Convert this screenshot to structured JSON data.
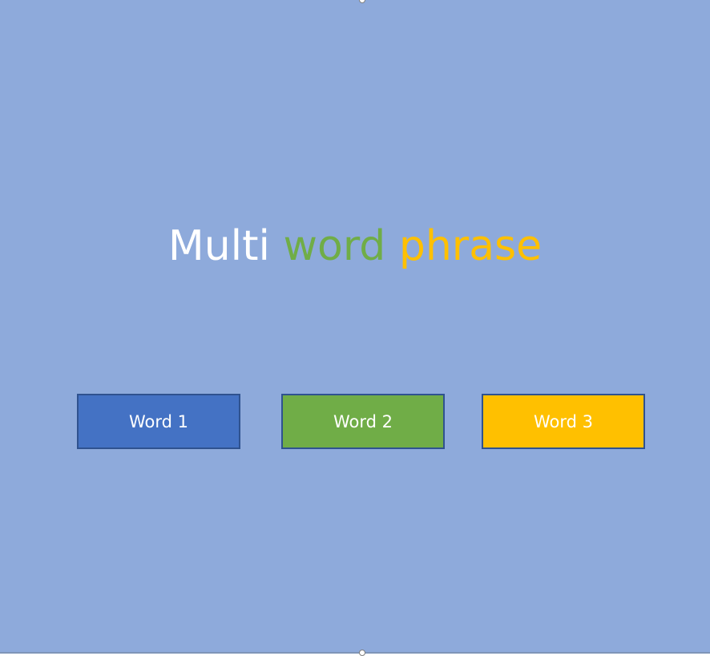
{
  "colors": {
    "background": "#8eaadb",
    "blue": "#4472c4",
    "green": "#70ad47",
    "gold": "#ffc000",
    "white": "#ffffff",
    "box_border": "#2f528f"
  },
  "phrase": {
    "part1": "Multi",
    "part2": "word",
    "part3": "phrase"
  },
  "boxes": [
    {
      "label": "Word 1",
      "color": "#4472c4"
    },
    {
      "label": "Word 2",
      "color": "#70ad47"
    },
    {
      "label": "Word 3",
      "color": "#ffc000"
    }
  ]
}
